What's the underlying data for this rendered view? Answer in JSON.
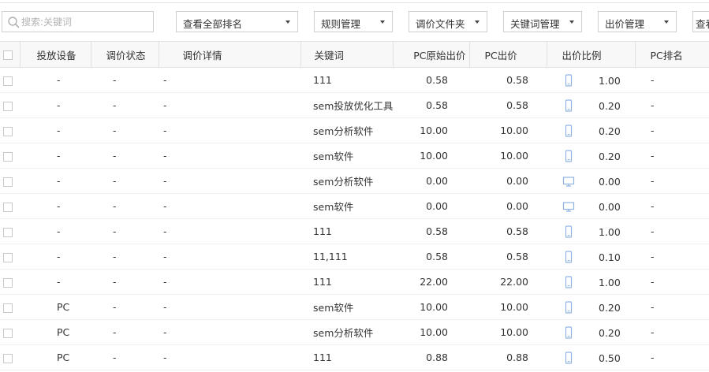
{
  "toolbar": {
    "search_placeholder": "搜索:关键词",
    "dropdowns": [
      {
        "label": "查看全部排名"
      },
      {
        "label": "规则管理"
      },
      {
        "label": "调价文件夹"
      },
      {
        "label": "关键词管理"
      },
      {
        "label": "出价管理"
      },
      {
        "label": "查看"
      }
    ]
  },
  "table": {
    "headers": {
      "device": "投放设备",
      "status": "调价状态",
      "detail": "调价详情",
      "keyword": "关键词",
      "pc_orig_bid": "PC原始出价",
      "pc_bid": "PC出价",
      "bid_ratio": "出价比例",
      "pc_rank": "PC排名"
    },
    "rows": [
      {
        "device": "-",
        "status": "-",
        "detail": "-",
        "keyword": "111",
        "orig": "0.58",
        "bid": "0.58",
        "icon": "mobile-icon",
        "ratio": "1.00",
        "rank": "-"
      },
      {
        "device": "-",
        "status": "-",
        "detail": "-",
        "keyword": "sem投放优化工具",
        "orig": "0.58",
        "bid": "0.58",
        "icon": "mobile-icon",
        "ratio": "0.20",
        "rank": "-"
      },
      {
        "device": "-",
        "status": "-",
        "detail": "-",
        "keyword": "sem分析软件",
        "orig": "10.00",
        "bid": "10.00",
        "icon": "mobile-icon",
        "ratio": "0.20",
        "rank": "-"
      },
      {
        "device": "-",
        "status": "-",
        "detail": "-",
        "keyword": "sem软件",
        "orig": "10.00",
        "bid": "10.00",
        "icon": "mobile-icon",
        "ratio": "0.20",
        "rank": "-"
      },
      {
        "device": "-",
        "status": "-",
        "detail": "-",
        "keyword": "sem分析软件",
        "orig": "0.00",
        "bid": "0.00",
        "icon": "desktop-icon",
        "ratio": "0.00",
        "rank": "-"
      },
      {
        "device": "-",
        "status": "-",
        "detail": "-",
        "keyword": "sem软件",
        "orig": "0.00",
        "bid": "0.00",
        "icon": "desktop-icon",
        "ratio": "0.00",
        "rank": "-"
      },
      {
        "device": "-",
        "status": "-",
        "detail": "-",
        "keyword": "111",
        "orig": "0.58",
        "bid": "0.58",
        "icon": "mobile-icon",
        "ratio": "1.00",
        "rank": "-"
      },
      {
        "device": "-",
        "status": "-",
        "detail": "-",
        "keyword": "11,111",
        "orig": "0.58",
        "bid": "0.58",
        "icon": "mobile-icon",
        "ratio": "0.10",
        "rank": "-"
      },
      {
        "device": "-",
        "status": "-",
        "detail": "-",
        "keyword": "111",
        "orig": "22.00",
        "bid": "22.00",
        "icon": "mobile-icon",
        "ratio": "1.00",
        "rank": "-"
      },
      {
        "device": "PC",
        "status": "-",
        "detail": "-",
        "keyword": "sem软件",
        "orig": "10.00",
        "bid": "10.00",
        "icon": "mobile-icon",
        "ratio": "0.20",
        "rank": "-"
      },
      {
        "device": "PC",
        "status": "-",
        "detail": "-",
        "keyword": "sem分析软件",
        "orig": "10.00",
        "bid": "10.00",
        "icon": "mobile-icon",
        "ratio": "0.20",
        "rank": "-"
      },
      {
        "device": "PC",
        "status": "-",
        "detail": "-",
        "keyword": "111",
        "orig": "0.88",
        "bid": "0.88",
        "icon": "mobile-icon",
        "ratio": "0.50",
        "rank": "-"
      }
    ]
  },
  "colors": {
    "border": "#cfcfcf",
    "header_bg": "#f8f8f8",
    "icon": "#8fb3e0"
  }
}
